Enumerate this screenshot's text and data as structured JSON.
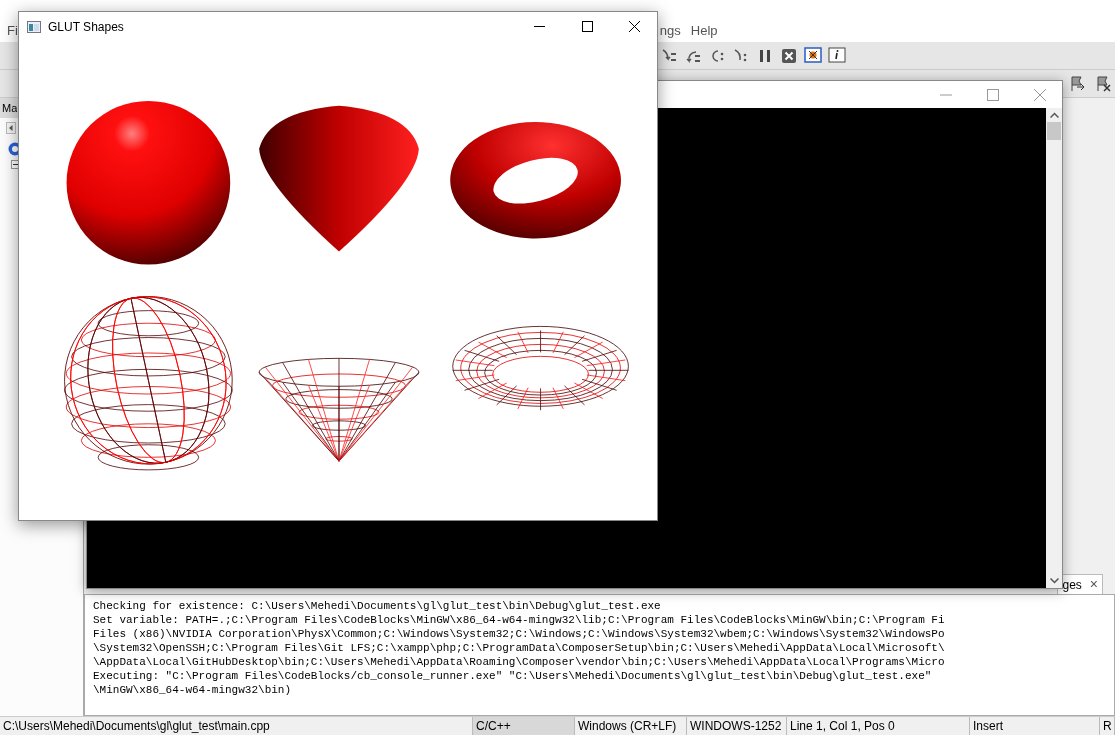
{
  "ide": {
    "menu": [
      "Fi",
      "ngs",
      "Help"
    ],
    "side_panel_tab": "Ma",
    "log_tab": {
      "label": "ges",
      "close": "×"
    },
    "log_lines": [
      "Checking for existence: C:\\Users\\Mehedi\\Documents\\gl\\glut_test\\bin\\Debug\\glut_test.exe",
      "Set variable: PATH=.;C:\\Program Files\\CodeBlocks\\MinGW\\x86_64-w64-mingw32\\lib;C:\\Program Files\\CodeBlocks\\MinGW\\bin;C:\\Program Fi",
      "Files (x86)\\NVIDIA Corporation\\PhysX\\Common;C:\\Windows\\System32;C:\\Windows;C:\\Windows\\System32\\wbem;C:\\Windows\\System32\\WindowsPo",
      "\\System32\\OpenSSH;C:\\Program Files\\Git LFS;C:\\xampp\\php;C:\\ProgramData\\ComposerSetup\\bin;C:\\Users\\Mehedi\\AppData\\Local\\Microsoft\\",
      "\\AppData\\Local\\GitHubDesktop\\bin;C:\\Users\\Mehedi\\AppData\\Roaming\\Composer\\vendor\\bin;C:\\Users\\Mehedi\\AppData\\Local\\Programs\\Micro",
      "Executing: \"C:\\Program Files\\CodeBlocks/cb_console_runner.exe\" \"C:\\Users\\Mehedi\\Documents\\gl\\glut_test\\bin\\Debug\\glut_test.exe\"",
      "\\MinGW\\x86_64-w64-mingw32\\bin)"
    ],
    "status_bar": [
      "C:\\Users\\Mehedi\\Documents\\gl\\glut_test\\main.cpp",
      "C/C++",
      "Windows (CR+LF)",
      "WINDOWS-1252",
      "Line 1, Col 1, Pos 0",
      "Insert",
      "R"
    ]
  },
  "glut_window": {
    "title": "GLUT Shapes"
  }
}
